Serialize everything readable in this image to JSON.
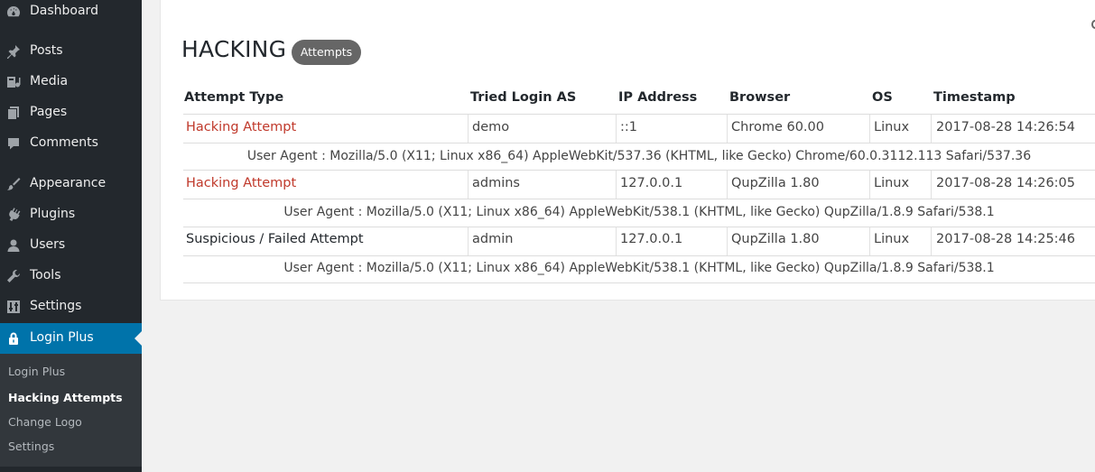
{
  "sidebar": {
    "items": [
      {
        "label": "Dashboard",
        "icon": "dashboard-icon"
      },
      {
        "label": "Posts",
        "icon": "pin-icon"
      },
      {
        "label": "Media",
        "icon": "media-icon"
      },
      {
        "label": "Pages",
        "icon": "pages-icon"
      },
      {
        "label": "Comments",
        "icon": "comments-icon"
      },
      {
        "label": "Appearance",
        "icon": "brush-icon"
      },
      {
        "label": "Plugins",
        "icon": "plugin-icon"
      },
      {
        "label": "Users",
        "icon": "users-icon"
      },
      {
        "label": "Tools",
        "icon": "wrench-icon"
      },
      {
        "label": "Settings",
        "icon": "settings-icon"
      },
      {
        "label": "Login Plus",
        "icon": "lock-icon"
      }
    ],
    "submenu": [
      {
        "label": "Login Plus"
      },
      {
        "label": "Hacking Attempts"
      },
      {
        "label": "Change Logo"
      },
      {
        "label": "Settings"
      }
    ]
  },
  "page": {
    "title": "HACKING",
    "badge": "Attempts"
  },
  "table": {
    "headers": [
      "Attempt Type",
      "Tried Login AS",
      "IP Address",
      "Browser",
      "OS",
      "Timestamp"
    ],
    "rows": [
      {
        "type": "Hacking Attempt",
        "login": "demo",
        "ip": "::1",
        "browser": "Chrome 60.00",
        "os": "Linux",
        "timestamp": "2017-08-28 14:26:54",
        "user_agent": "User Agent : Mozilla/5.0 (X11; Linux x86_64) AppleWebKit/537.36 (KHTML, like Gecko) Chrome/60.0.3112.113 Safari/537.36"
      },
      {
        "type": "Hacking Attempt",
        "login": "admins",
        "ip": "127.0.0.1",
        "browser": "QupZilla 1.80",
        "os": "Linux",
        "timestamp": "2017-08-28 14:26:05",
        "user_agent": "User Agent : Mozilla/5.0 (X11; Linux x86_64) AppleWebKit/538.1 (KHTML, like Gecko) QupZilla/1.8.9 Safari/538.1"
      },
      {
        "type": "Suspicious / Failed Attempt",
        "login": "admin",
        "ip": "127.0.0.1",
        "browser": "QupZilla 1.80",
        "os": "Linux",
        "timestamp": "2017-08-28 14:25:46",
        "user_agent": "User Agent : Mozilla/5.0 (X11; Linux x86_64) AppleWebKit/538.1 (KHTML, like Gecko) QupZilla/1.8.9 Safari/538.1"
      }
    ]
  },
  "colors": {
    "sidebar_bg": "#23282d",
    "active_bg": "#0073aa",
    "hack_link": "#c0392b",
    "badge_bg": "#666666"
  }
}
